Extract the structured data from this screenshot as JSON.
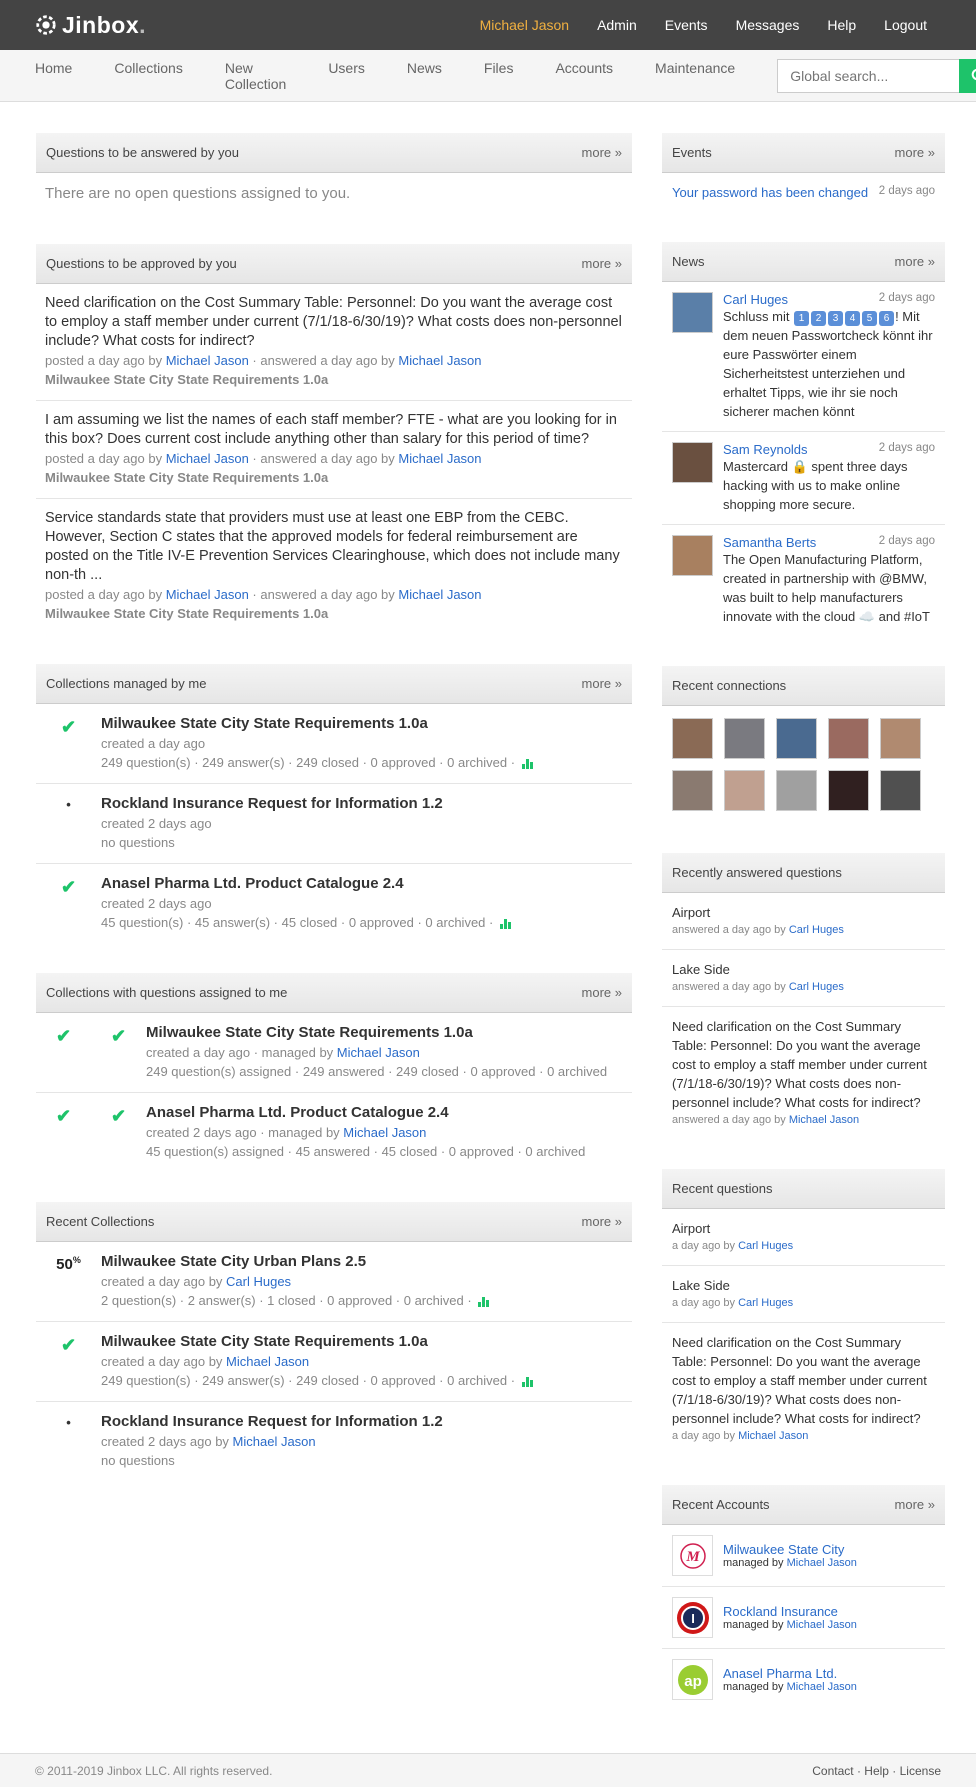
{
  "brand": {
    "name": "Jinbox",
    "dot": "."
  },
  "topnav": [
    {
      "label": "Michael Jason",
      "active": true
    },
    {
      "label": "Admin"
    },
    {
      "label": "Events"
    },
    {
      "label": "Messages"
    },
    {
      "label": "Help"
    },
    {
      "label": "Logout"
    }
  ],
  "subnav": [
    "Home",
    "Collections",
    "New Collection",
    "Users",
    "News",
    "Files",
    "Accounts",
    "Maintenance"
  ],
  "search": {
    "placeholder": "Global search..."
  },
  "more_label": "more »",
  "questions_answered": {
    "title": "Questions to be answered by you",
    "empty": "There are no open questions assigned to you."
  },
  "questions_approved": {
    "title": "Questions to be approved by you",
    "items": [
      {
        "text": "Need clarification on the Cost Summary Table: Personnel: Do you want the average cost to employ a staff member under current (7/1/18-6/30/19)? What costs does non-personnel include? What costs for indirect?",
        "posted": "posted a day ago by ",
        "user1": "Michael Jason",
        "answered": " · answered a day ago by ",
        "user2": "Michael Jason",
        "collection": "Milwaukee State City State Requirements 1.0a"
      },
      {
        "text": "I am assuming we list the names of each staff member? FTE - what are you looking for in this box? Does current cost include anything other than salary for this period of time?",
        "posted": "posted a day ago by ",
        "user1": "Michael Jason",
        "answered": " · answered a day ago by ",
        "user2": "Michael Jason",
        "collection": "Milwaukee State City State Requirements 1.0a"
      },
      {
        "text": "Service standards state that providers must use at least one EBP from the CEBC. However, Section C states that the approved models for federal reimbursement are posted on the Title IV-E Prevention Services Clearinghouse, which does not include many non-th ...",
        "posted": "posted a day ago by ",
        "user1": "Michael Jason",
        "answered": " · answered a day ago by ",
        "user2": "Michael Jason",
        "collection": "Milwaukee State City State Requirements 1.0a"
      }
    ]
  },
  "collections_managed": {
    "title": "Collections managed by me",
    "items": [
      {
        "status": "check",
        "name": "Milwaukee State City State Requirements 1.0a",
        "created": "created a day ago",
        "stats": "249 question(s) · 249 answer(s) · 249 closed · 0 approved · 0 archived · ",
        "chart": true
      },
      {
        "status": "dot",
        "name": "Rockland Insurance Request for Information 1.2",
        "created": "created 2 days ago",
        "stats": "no questions",
        "chart": false
      },
      {
        "status": "check",
        "name": "Anasel Pharma Ltd. Product Catalogue 2.4",
        "created": "created 2 days ago",
        "stats": "45 question(s) · 45 answer(s) · 45 closed · 0 approved · 0 archived · ",
        "chart": true
      }
    ]
  },
  "collections_assigned": {
    "title": "Collections with questions assigned to me",
    "items": [
      {
        "name": "Milwaukee State City State Requirements 1.0a",
        "created": "created a day ago · managed by ",
        "manager": "Michael Jason",
        "stats": "249 question(s) assigned · 249 answered · 249 closed · 0 approved · 0 archived"
      },
      {
        "name": "Anasel Pharma Ltd. Product Catalogue 2.4",
        "created": "created 2 days ago · managed by ",
        "manager": "Michael Jason",
        "stats": "45 question(s) assigned · 45 answered · 45 closed · 0 approved · 0 archived"
      }
    ]
  },
  "recent_collections": {
    "title": "Recent Collections",
    "items": [
      {
        "status": "50",
        "pct": "%",
        "name": "Milwaukee State City Urban Plans 2.5",
        "created": "created a day ago by ",
        "user": "Carl Huges",
        "stats": "2 question(s) · 2 answer(s) · 1 closed · 0 approved · 0 archived · "
      },
      {
        "status": "check",
        "name": "Milwaukee State City State Requirements 1.0a",
        "created": "created a day ago by ",
        "user": "Michael Jason",
        "stats": "249 question(s) · 249 answer(s) · 249 closed · 0 approved · 0 archived · "
      },
      {
        "status": "dot",
        "name": "Rockland Insurance Request for Information 1.2",
        "created": "created 2 days ago by ",
        "user": "Michael Jason",
        "stats": "no questions"
      }
    ]
  },
  "events": {
    "title": "Events",
    "items": [
      {
        "text": "Your password has been changed",
        "date": "2 days ago"
      }
    ]
  },
  "news": {
    "title": "News",
    "items": [
      {
        "user": "Carl Huges",
        "date": "2 days ago",
        "pre": "Schluss mit ",
        "nums": [
          "1",
          "2",
          "3",
          "4",
          "5",
          "6"
        ],
        "post": "! Mit dem neuen Passwortcheck könnt ihr eure Passwörter einem Sicherheitstest unterziehen und erhaltet Tipps, wie ihr sie noch sicherer machen könnt",
        "color": "#5a7fa8"
      },
      {
        "user": "Sam Reynolds",
        "date": "2 days ago",
        "text": "Mastercard 🔒 spent three days hacking with us to make online shopping more secure.",
        "color": "#6a5040"
      },
      {
        "user": "Samantha Berts",
        "date": "2 days ago",
        "text": "The Open Manufacturing Platform, created in partnership with @BMW, was built to help manufacturers innovate with the cloud ☁️ and #IoT",
        "color": "#a88060"
      }
    ]
  },
  "connections": {
    "title": "Recent connections",
    "colors": [
      "#8a6a55",
      "#7a7a80",
      "#4a6a90",
      "#9a6a60",
      "#b08a70",
      "#8a7a70",
      "#c0a090",
      "#a0a0a0",
      "#302020",
      "#505050"
    ]
  },
  "recently_answered": {
    "title": "Recently answered questions",
    "items": [
      {
        "text": "Airport",
        "meta": "answered a day ago by ",
        "user": "Carl Huges"
      },
      {
        "text": "Lake Side",
        "meta": "answered a day ago by ",
        "user": "Carl Huges"
      },
      {
        "text": "Need clarification on the Cost Summary Table: Personnel: Do you want the average cost to employ a staff member under current (7/1/18-6/30/19)? What costs does non-personnel include? What costs for indirect?",
        "meta": "answered a day ago by ",
        "user": "Michael Jason"
      }
    ]
  },
  "recent_questions": {
    "title": "Recent questions",
    "items": [
      {
        "text": "Airport",
        "meta": "a day ago by ",
        "user": "Carl Huges"
      },
      {
        "text": "Lake Side",
        "meta": "a day ago by ",
        "user": "Carl Huges"
      },
      {
        "text": "Need clarification on the Cost Summary Table: Personnel: Do you want the average cost to employ a staff member under current (7/1/18-6/30/19)? What costs does non-personnel include? What costs for indirect?",
        "meta": "a day ago by ",
        "user": "Michael Jason"
      }
    ]
  },
  "recent_accounts": {
    "title": "Recent Accounts",
    "items": [
      {
        "name": "Milwaukee State City",
        "meta": "managed by ",
        "user": "Michael Jason",
        "logo": "M"
      },
      {
        "name": "Rockland Insurance",
        "meta": "managed by ",
        "user": "Michael Jason",
        "logo": "I"
      },
      {
        "name": "Anasel Pharma Ltd.",
        "meta": "managed by ",
        "user": "Michael Jason",
        "logo": "ap"
      }
    ]
  },
  "footer": {
    "copyright": "© 2011-2019 Jinbox LLC. All rights reserved.",
    "links": "Contact · Help · License"
  },
  "colors": {
    "accent": "#1ec36a",
    "link": "#2a6bc9",
    "topbar": "#444444",
    "active": "#f0b040"
  }
}
